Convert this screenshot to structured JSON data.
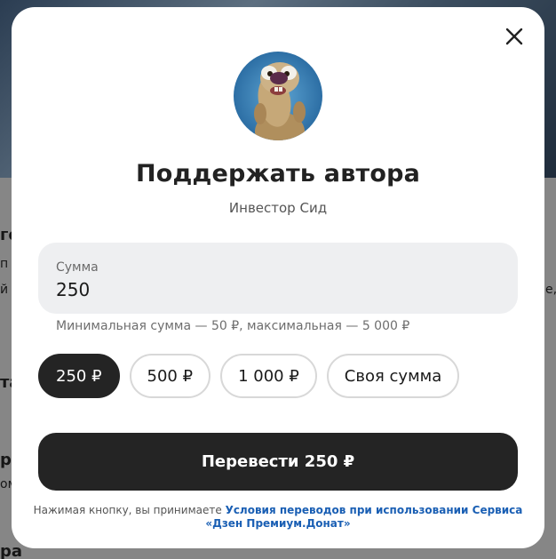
{
  "background": {
    "fragments": [
      "го",
      "п",
      "й к",
      "та",
      "ра",
      "ому",
      "ра",
      "e,"
    ]
  },
  "modal": {
    "close_icon": "close-icon",
    "avatar_icon": "avatar-image",
    "title": "Поддержать автора",
    "author_name": "Инвестор Сид",
    "amount": {
      "label": "Сумма",
      "value": "250"
    },
    "hint": "Минимальная сумма — 50 ₽, максимальная — 5 000 ₽",
    "presets": [
      {
        "label": "250 ₽",
        "selected": true
      },
      {
        "label": "500 ₽",
        "selected": false
      },
      {
        "label": "1 000 ₽",
        "selected": false
      },
      {
        "label": "Своя сумма",
        "selected": false
      }
    ],
    "submit_label": "Перевести 250 ₽",
    "legal": {
      "prefix": "Нажимая кнопку, вы принимаете",
      "link": "Условия переводов при использовании Сервиса «Дзен Премиум.Донат»"
    },
    "colors": {
      "primary_button": "#242424",
      "link": "#1a5fb4",
      "field_background": "#eeeff1"
    }
  }
}
